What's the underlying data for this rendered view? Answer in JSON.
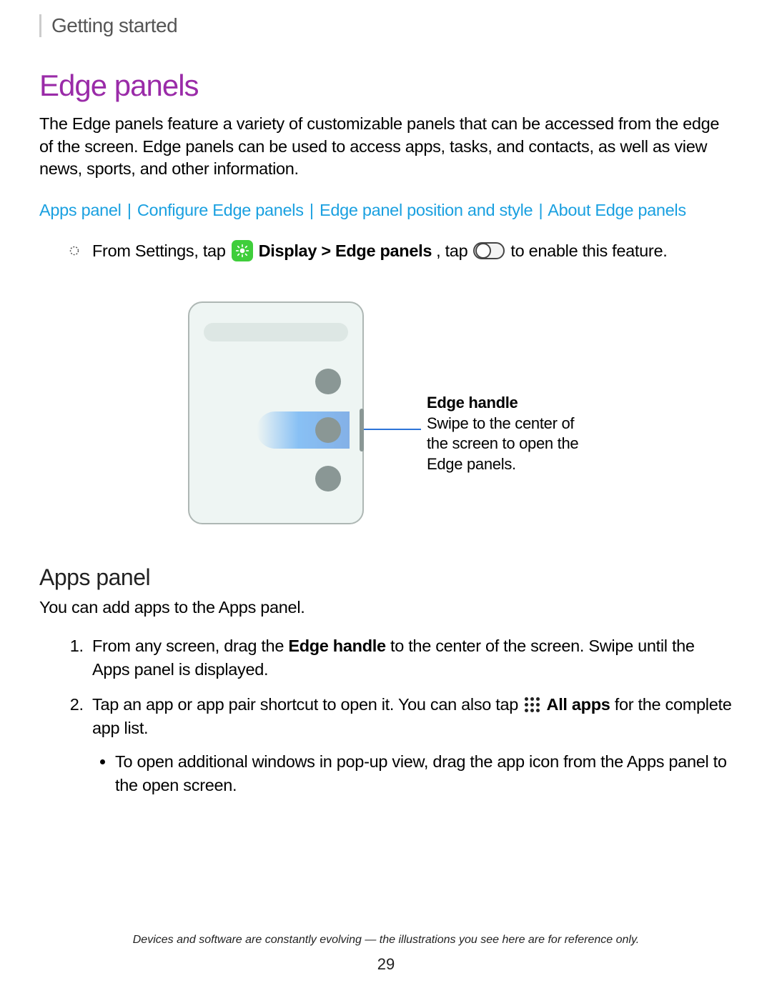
{
  "breadcrumb": "Getting started",
  "title": "Edge panels",
  "intro": "The Edge panels feature a variety of customizable panels that can be accessed from the edge of the screen. Edge panels can be used to access apps, tasks, and contacts, as well as view news, sports, and other information.",
  "links": {
    "apps_panel": "Apps panel",
    "configure": "Configure Edge panels",
    "position": "Edge panel position and style",
    "about": "About Edge panels",
    "sep": "|"
  },
  "instruction": {
    "part1": "From Settings, tap",
    "display_edge": "Display > Edge panels",
    "part2": ", tap",
    "part3": "to enable this feature."
  },
  "callout": {
    "title": "Edge handle",
    "text": "Swipe to the center of the screen to open the Edge panels."
  },
  "subsection_title": "Apps panel",
  "subsection_intro": "You can add apps to the Apps panel.",
  "steps": {
    "s1_a": "From any screen, drag the ",
    "s1_b": "Edge handle",
    "s1_c": " to the center of the screen. Swipe until the Apps panel is displayed.",
    "s2_a": "Tap an app or app pair shortcut to open it. You can also tap",
    "s2_b": "All apps",
    "s2_c": " for the complete app list.",
    "s2_sub": "To open additional windows in pop-up view, drag the app icon from the Apps panel to the open screen."
  },
  "footer_note": "Devices and software are constantly evolving — the illustrations you see here are for reference only.",
  "page_number": "29"
}
